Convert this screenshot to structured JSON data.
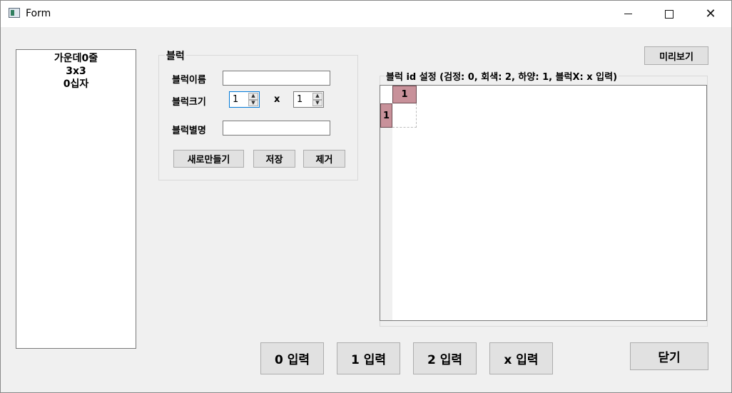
{
  "window": {
    "title": "Form",
    "close_glyph": "✕"
  },
  "block_list": {
    "items": [
      "가운데0줄",
      "3x3",
      "0십자"
    ]
  },
  "block_group": {
    "legend": "블럭",
    "name_label": "블럭이름",
    "name_value": "",
    "size_label": "블럭크기",
    "width_value": "1",
    "separator": "x",
    "height_value": "1",
    "alias_label": "블럭별명",
    "alias_value": "",
    "new_button": "새로만들기",
    "save_button": "저장",
    "remove_button": "제거"
  },
  "preview_button": "미리보기",
  "grid": {
    "legend": "블럭 id 설정 (검정: 0,  회색: 2,  하양: 1,  블럭X: x  입력)",
    "col_headers": [
      "1"
    ],
    "row_headers": [
      "1"
    ],
    "header_color": "#c8919a"
  },
  "input_buttons": [
    "0 입력",
    "1 입력",
    "2 입력",
    "x 입력"
  ],
  "close_button": "닫기",
  "icons": {
    "app": "window-app-icon",
    "spin_up": "▲",
    "spin_down": "▼"
  }
}
